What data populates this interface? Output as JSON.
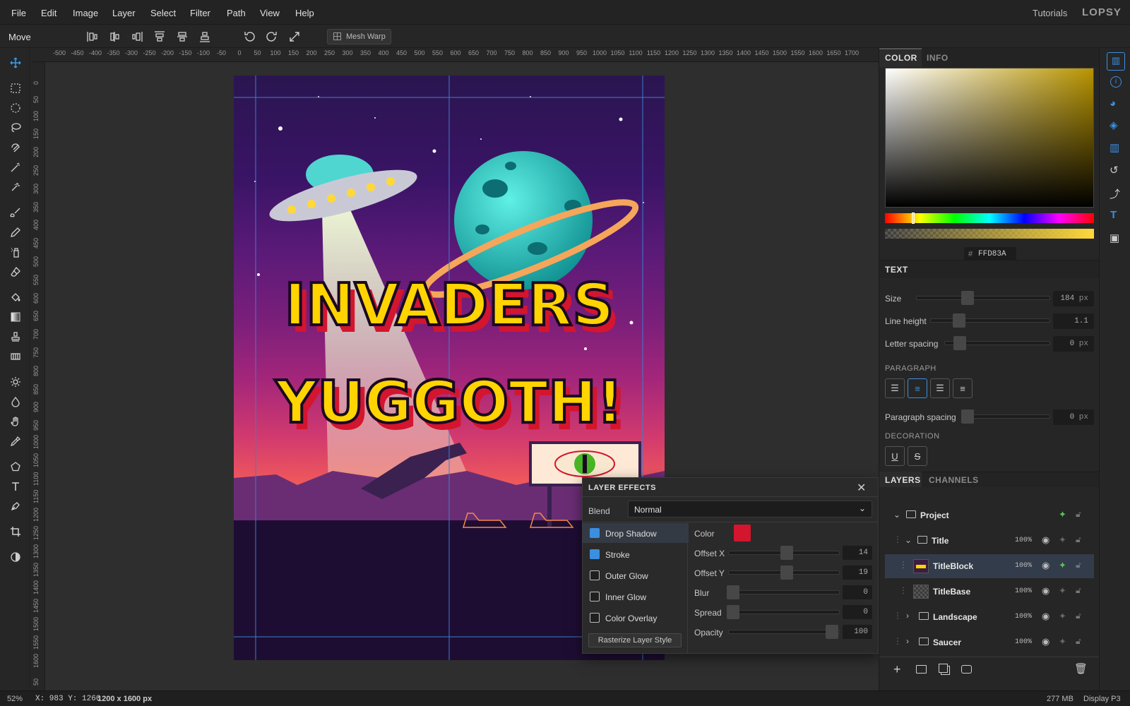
{
  "menu": [
    "File",
    "Edit",
    "Image",
    "Layer",
    "Select",
    "Filter",
    "Path",
    "View",
    "Help"
  ],
  "header_right": {
    "tutorials": "Tutorials",
    "logo": "LOPSY"
  },
  "options": {
    "tool_name": "Move",
    "mesh_warp": "Mesh Warp"
  },
  "ruler_top": [
    "-500",
    "-450",
    "-400",
    "-350",
    "-300",
    "-250",
    "-200",
    "-150",
    "-100",
    "-50",
    "0",
    "50",
    "100",
    "150",
    "200",
    "250",
    "300",
    "350",
    "400",
    "450",
    "500",
    "550",
    "600",
    "650",
    "700",
    "750",
    "800",
    "850",
    "900",
    "950",
    "1000",
    "1050",
    "1100",
    "1150",
    "1200",
    "1250",
    "1300",
    "1350",
    "1400",
    "1450",
    "1500",
    "1550",
    "1600",
    "1650",
    "1700"
  ],
  "ruler_left": [
    "0",
    "50",
    "100",
    "150",
    "200",
    "250",
    "300",
    "350",
    "400",
    "450",
    "500",
    "550",
    "600",
    "650",
    "700",
    "750",
    "800",
    "850",
    "900",
    "950",
    "1000",
    "1050",
    "1100",
    "1150",
    "1200",
    "1250",
    "1300",
    "1350",
    "1400",
    "1450",
    "1500",
    "1550",
    "1600",
    "50"
  ],
  "poster": {
    "line1": "INVADERS",
    "line2": "YUGGOTH!"
  },
  "color_panel": {
    "tabs": [
      "COLOR",
      "INFO"
    ],
    "hex_prefix": "#",
    "hex": "FFD83A",
    "accent": "#FFD83A"
  },
  "text_panel": {
    "tab": "TEXT",
    "size": {
      "label": "Size",
      "value": "184",
      "unit": "px"
    },
    "line_height": {
      "label": "Line height",
      "value": "1.1"
    },
    "letter_spacing": {
      "label": "Letter spacing",
      "value": "0",
      "unit": "px"
    },
    "paragraph_label": "PARAGRAPH",
    "paragraph_spacing": {
      "label": "Paragraph spacing",
      "value": "0",
      "unit": "px"
    },
    "decoration_label": "DECORATION",
    "decoration_buttons": [
      "U",
      "S"
    ]
  },
  "layers_panel": {
    "tabs": [
      "LAYERS",
      "CHANNELS"
    ],
    "rows": [
      {
        "name": "Project",
        "opacity": ""
      },
      {
        "name": "Title",
        "opacity": "100%"
      },
      {
        "name": "TitleBlock",
        "opacity": "100%"
      },
      {
        "name": "TitleBase",
        "opacity": "100%"
      },
      {
        "name": "Landscape",
        "opacity": "100%"
      },
      {
        "name": "Saucer",
        "opacity": "100%"
      }
    ]
  },
  "layer_effects": {
    "title": "LAYER EFFECTS",
    "blend_label": "Blend",
    "blend_value": "Normal",
    "effects": [
      {
        "name": "Drop Shadow",
        "checked": true
      },
      {
        "name": "Stroke",
        "checked": true
      },
      {
        "name": "Outer Glow",
        "checked": false
      },
      {
        "name": "Inner Glow",
        "checked": false
      },
      {
        "name": "Color Overlay",
        "checked": false
      }
    ],
    "rasterize": "Rasterize Layer Style",
    "color_label": "Color",
    "shadow_color": "#D4152E",
    "params": [
      {
        "label": "Offset X",
        "value": "14"
      },
      {
        "label": "Offset Y",
        "value": "19"
      },
      {
        "label": "Blur",
        "value": "0"
      },
      {
        "label": "Spread",
        "value": "0"
      },
      {
        "label": "Opacity",
        "value": "100"
      }
    ]
  },
  "status": {
    "zoom": "52%",
    "coords": "X: 983  Y: 1260",
    "size": "1200 x 1600 px",
    "memory": "277 MB",
    "display": "Display P3"
  }
}
